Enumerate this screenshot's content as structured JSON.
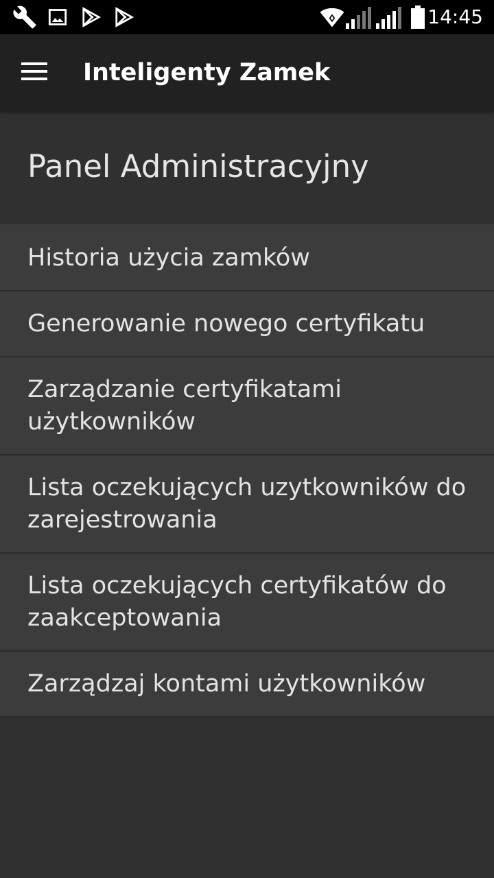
{
  "status_bar": {
    "time": "14:45",
    "icons": [
      "wrench-icon",
      "image-icon",
      "play-store-icon",
      "play-store-icon",
      "wifi-icon",
      "signal-icon",
      "signal-icon",
      "battery-icon"
    ]
  },
  "app_bar": {
    "menu_icon": "hamburger-menu-icon",
    "title": "Inteligenty Zamek"
  },
  "panel": {
    "title": "Panel Administracyjny"
  },
  "menu": {
    "items": [
      {
        "label": "Historia użycia zamków"
      },
      {
        "label": "Generowanie nowego certyfikatu"
      },
      {
        "label": "Zarządzanie certyfikatami użytkowników"
      },
      {
        "label": "Lista oczekujących uzytkowników do zarejestrowania"
      },
      {
        "label": "Lista oczekujących certyfikatów do zaakceptowania"
      },
      {
        "label": "Zarządzaj kontami użytkowników"
      }
    ]
  },
  "colors": {
    "status_bar": "#000000",
    "app_bar": "#212121",
    "background": "#303030",
    "list_item": "#3c3c3c",
    "text": "#e3e3e3"
  }
}
